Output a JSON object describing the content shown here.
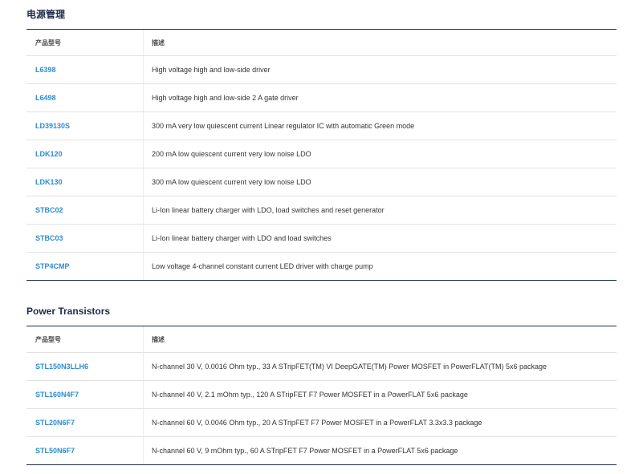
{
  "sections": [
    {
      "title": "电源管理",
      "headers": {
        "part": "产品型号",
        "desc": "描述"
      },
      "rows": [
        {
          "part": "L6398",
          "desc": "High voltage high and low-side driver"
        },
        {
          "part": "L6498",
          "desc": "High voltage high and low-side 2 A gate driver"
        },
        {
          "part": "LD39130S",
          "desc": "300 mA very low quiescent current Linear regulator IC with automatic Green mode"
        },
        {
          "part": "LDK120",
          "desc": "200 mA low quiescent current very low noise LDO"
        },
        {
          "part": "LDK130",
          "desc": "300 mA low quiescent current very low noise LDO"
        },
        {
          "part": "STBC02",
          "desc": "Li-Ion linear battery charger with LDO, load switches and reset generator"
        },
        {
          "part": "STBC03",
          "desc": "Li-Ion linear battery charger with LDO and load switches"
        },
        {
          "part": "STP4CMP",
          "desc": "Low voltage 4-channel constant current LED driver with charge pump"
        }
      ]
    },
    {
      "title": "Power Transistors",
      "headers": {
        "part": "产品型号",
        "desc": "描述"
      },
      "rows": [
        {
          "part": "STL150N3LLH6",
          "desc": "N-channel 30 V, 0.0016 Ohm typ., 33 A STripFET(TM) VI DeepGATE(TM) Power MOSFET in PowerFLAT(TM) 5x6 package"
        },
        {
          "part": "STL160N4F7",
          "desc": "N-channel 40 V, 2.1 mOhm typ., 120 A STripFET F7 Power MOSFET in a PowerFLAT 5x6 package"
        },
        {
          "part": "STL20N6F7",
          "desc": "N-channel 60 V, 0.0046 Ohm typ., 20 A STripFET F7 Power MOSFET in a PowerFLAT 3.3x3.3 package"
        },
        {
          "part": "STL50N6F7",
          "desc": "N-channel 60 V, 9 mOhm typ., 60 A STripFET F7 Power MOSFET in a PowerFLAT 5x6 package"
        }
      ]
    }
  ]
}
